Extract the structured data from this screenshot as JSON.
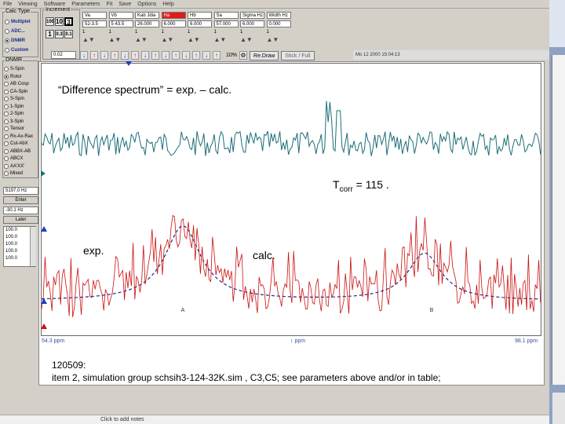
{
  "menu": [
    "File",
    "Viewing",
    "Software",
    "Parameters",
    "Fit",
    "Save",
    "Options",
    "Help"
  ],
  "left_panel": {
    "calc_type_title": "Calc Type",
    "calc_types": [
      "Multiplet",
      "ADC...",
      "DNMR",
      "Custom"
    ],
    "selected_calc_type": "DNMR",
    "dnmr_title": "DNMR",
    "dnmr_options": [
      "S-Spin",
      "Rotor",
      "AB Cosp",
      "CA-Spin",
      "S-Spin",
      "1-Spin",
      "2-Spin",
      "3-Spin",
      "Tensor",
      "Rx-Ax-Rax",
      "Cut-AbX",
      "ABBX-AB",
      "ABCX",
      "AA'XX'",
      "Mixed"
    ],
    "freq_value": "5197.0 Hz",
    "enter_btn": "Enter",
    "hz_value": "-30.1 Hz",
    "later_btn": "Later",
    "list_values": [
      "100.0",
      "100.0",
      "100.0",
      "100.0",
      "100.0"
    ]
  },
  "increment": {
    "title": "Increment",
    "buttons": [
      "100",
      "10",
      "3",
      "1",
      "0.3",
      "0.1"
    ],
    "value": "0.02"
  },
  "params": [
    {
      "name": "Va",
      "value": "52-3.5",
      "sub": "1"
    },
    {
      "name": "Vb",
      "value": "5 43.5",
      "sub": "1"
    },
    {
      "name": "Kab Jdia",
      "value": "26.000",
      "sub": "1"
    },
    {
      "name": "Ha",
      "value": "6.000",
      "sub": "1"
    },
    {
      "name": "Hb",
      "value": "6.000",
      "sub": "1"
    },
    {
      "name": "Sa",
      "value": "57.000",
      "sub": "1"
    },
    {
      "name": "Sigma Hz",
      "value": "6.000",
      "sub": "1"
    },
    {
      "name": "Width Hz",
      "value": "0.000",
      "sub": "1"
    }
  ],
  "toolbar": {
    "percent": "10%",
    "redraw": "Re.Draw",
    "stick_full": "Stick / Full",
    "datetime": "Mo 12 2000 15:04:13"
  },
  "plot": {
    "difference_label": "“Difference spectrum” = exp. – calc.",
    "tcorr_label": "T",
    "tcorr_sub": "corr",
    "tcorr_value": " = 115 .",
    "exp_label": "exp.",
    "calc_label": "calc.",
    "marker_a": "A",
    "marker_b": "B",
    "ppm_left": "54.3 ppm",
    "ppm_mid": "ppm",
    "ppm_right": "98.1 ppm"
  },
  "caption": {
    "line1": "120509:",
    "line2": "item 2, simulation group schsih3-124-32K.sim ,  C3,C5; see parameters above and/or in table;"
  },
  "statusbar": {
    "hint": "Click to add notes"
  },
  "colors": {
    "difference_trace": "#1c6e78",
    "exp_trace": "#cc1010",
    "calc_trace": "#1a2a8a",
    "highlight_param": "#e21a1a"
  }
}
